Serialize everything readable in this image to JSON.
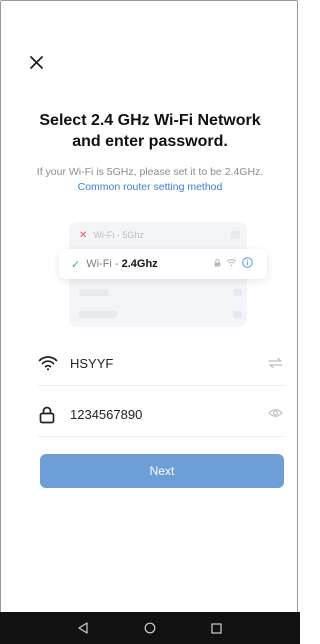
{
  "title": {
    "line1": "Select 2.4 GHz Wi-Fi Network",
    "line2": "and enter password."
  },
  "hint": {
    "text": "If your Wi-Fi is 5GHz, please set it to be 2.4GHz.",
    "link": "Common router setting method"
  },
  "illustration": {
    "row_5g_label": "Wi-Fi - 5Ghz",
    "row_24_prefix": "Wi-Fi -",
    "row_24_bold": "2.4Ghz"
  },
  "wifi": {
    "ssid": "HSYYF"
  },
  "password": {
    "value": "1234567890"
  },
  "next_label": "Next",
  "colors": {
    "accent": "#3a7fd6",
    "button": "#6e9ed8",
    "check": "#3bb26b",
    "cross": "#e25555"
  },
  "icons": {
    "close": "close-icon",
    "wifi": "wifi-icon",
    "lock": "lock-icon",
    "switch": "switch-network-icon",
    "eye": "eye-icon",
    "info": "info-icon"
  }
}
